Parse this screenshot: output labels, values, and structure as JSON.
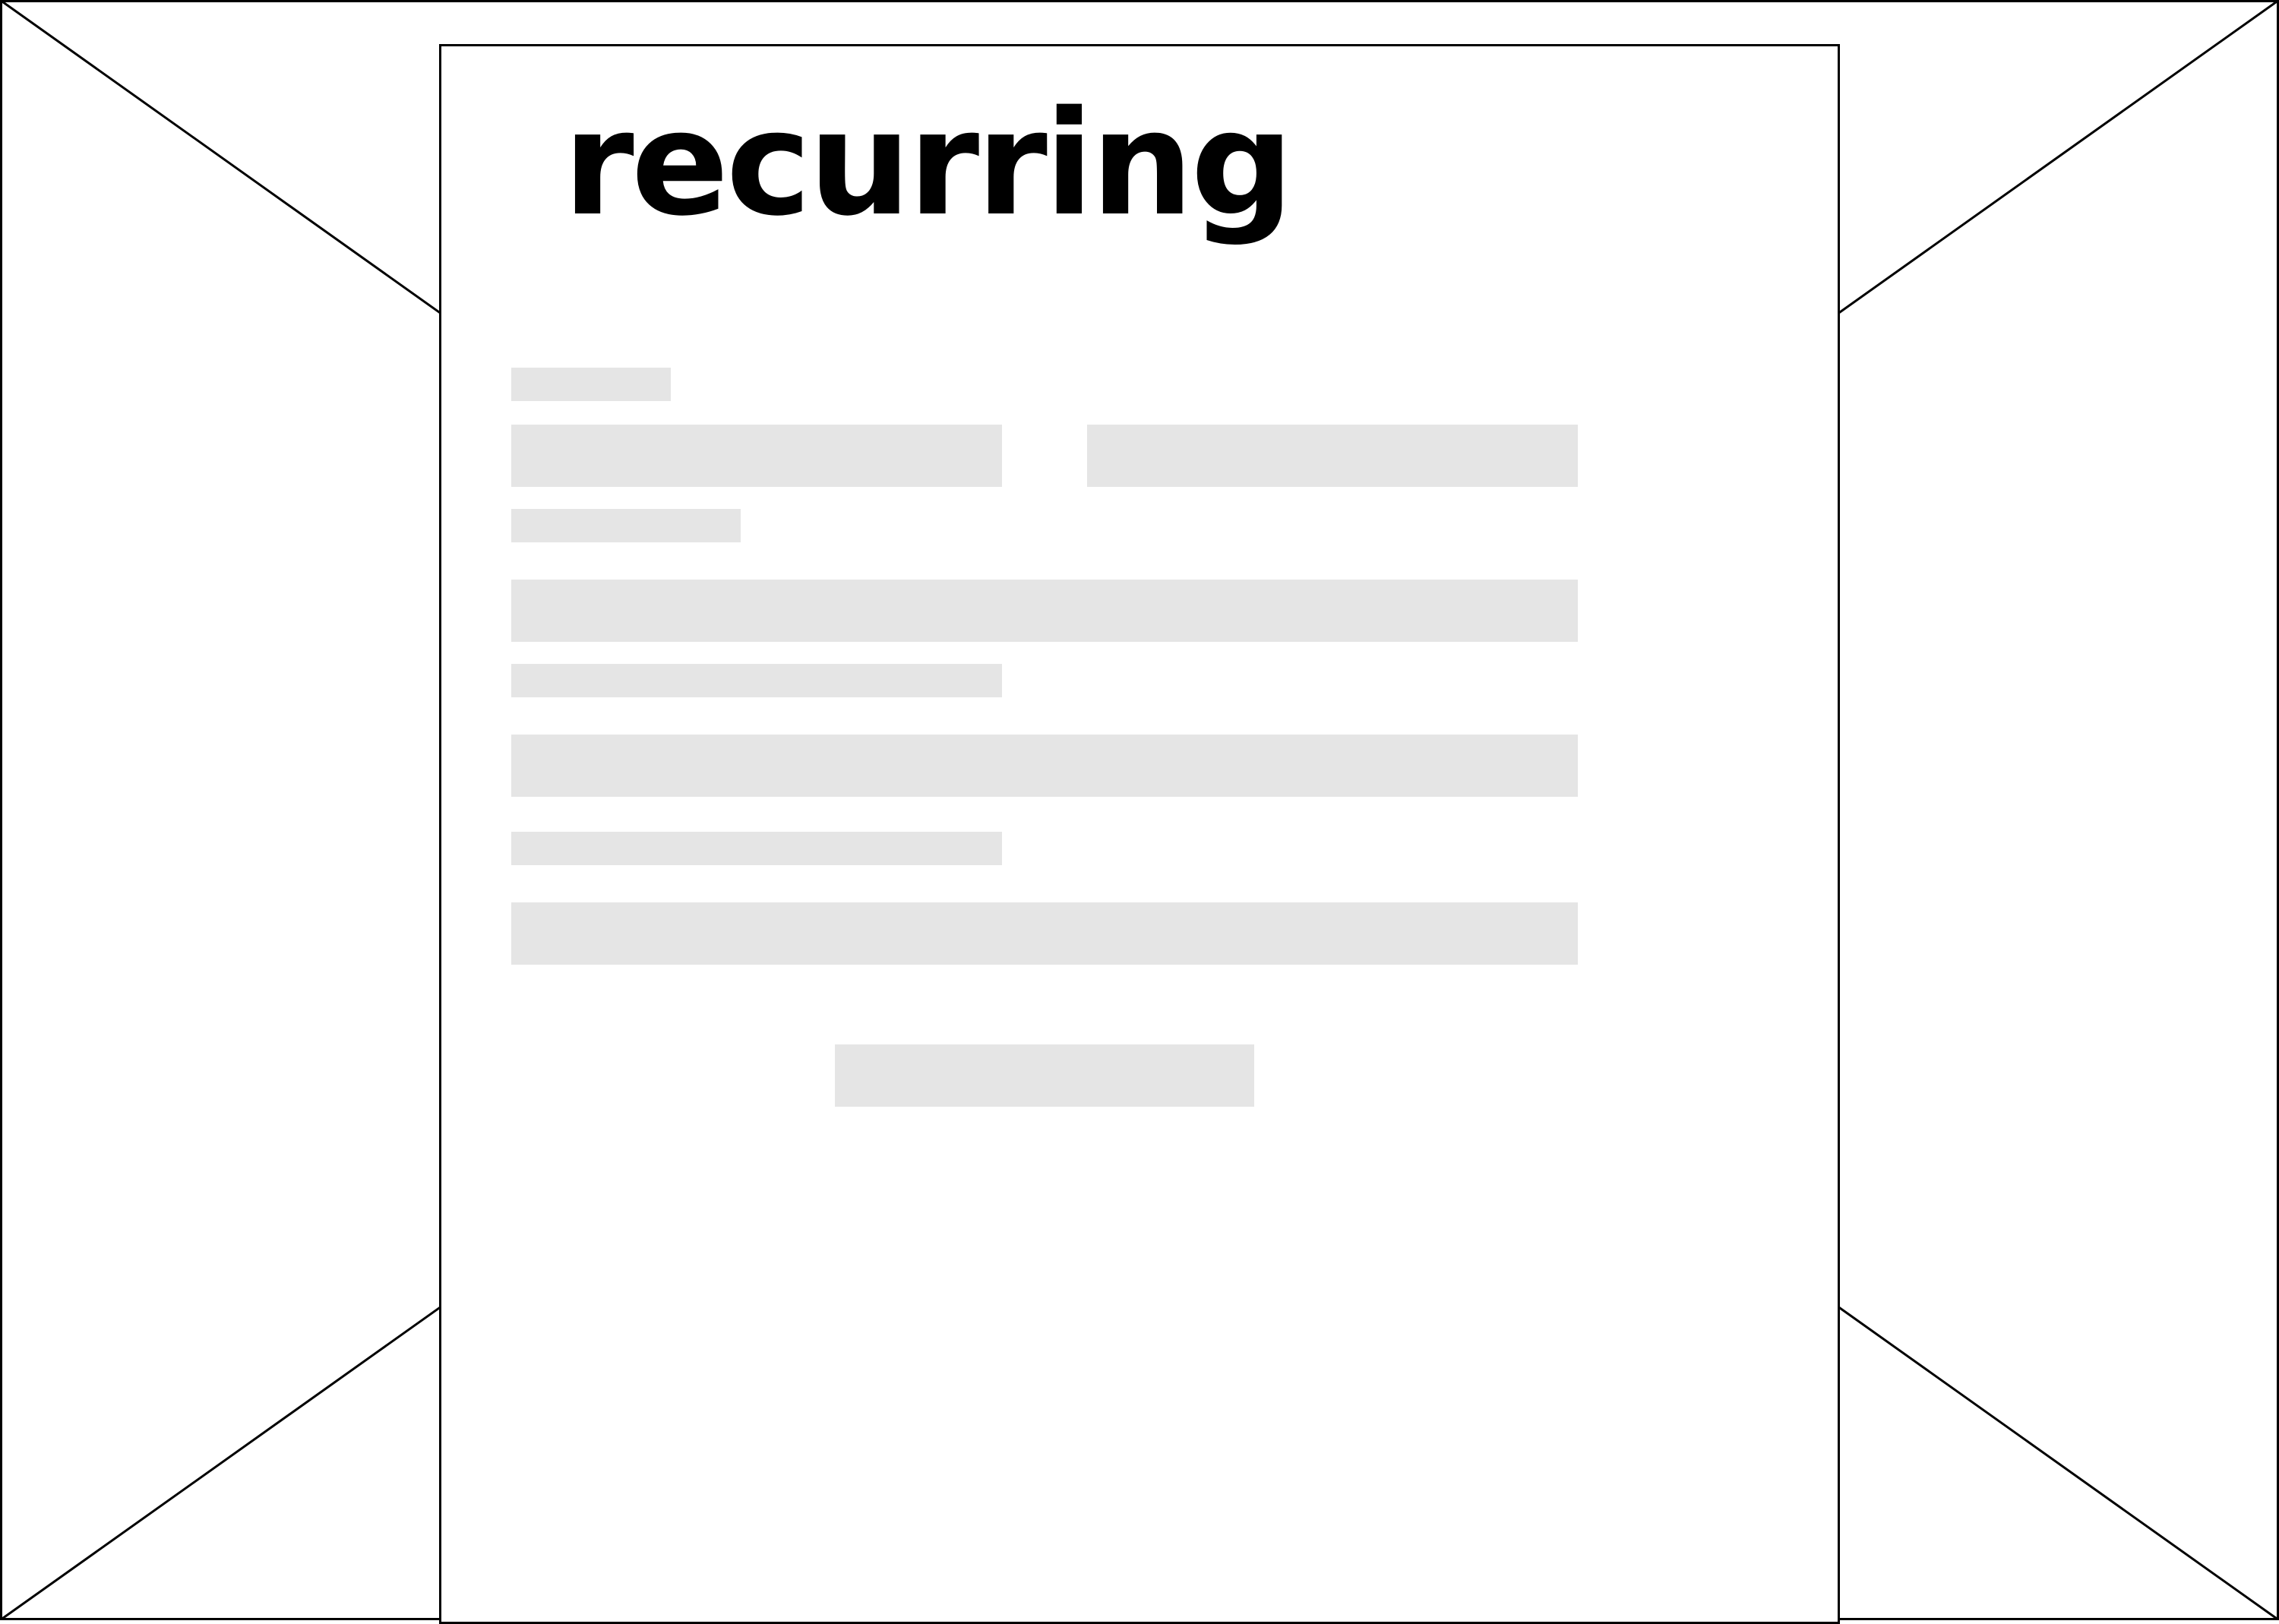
{
  "page": {
    "heading": "recurring"
  },
  "colors": {
    "placeholder": "#e5e5e5",
    "border": "#000000",
    "heading": "#000000",
    "background": "#ffffff"
  },
  "form": {
    "label_count_note": "",
    "placeholders": [
      "label-short",
      "input-half-left",
      "input-half-right",
      "label-medium",
      "input-full-1",
      "label-long-1",
      "input-full-2",
      "label-long-2",
      "input-full-3",
      "submit-button"
    ]
  }
}
